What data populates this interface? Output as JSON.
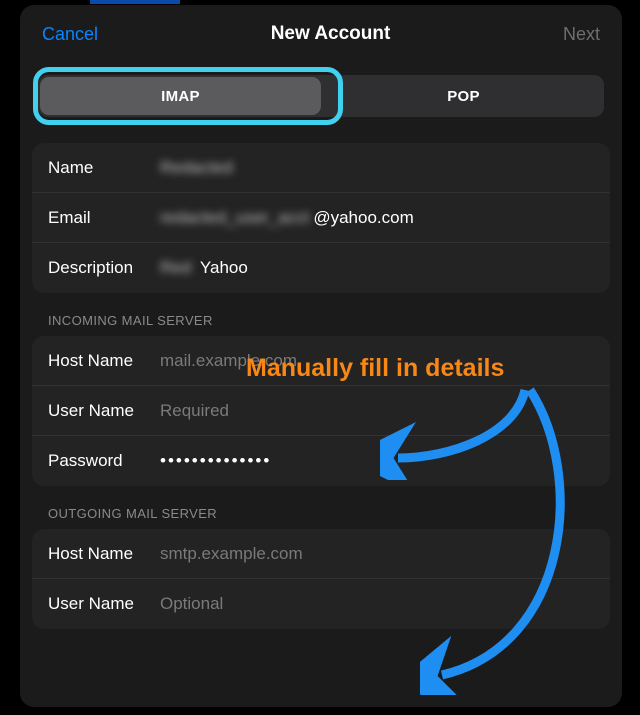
{
  "header": {
    "cancel_label": "Cancel",
    "title": "New Account",
    "next_label": "Next"
  },
  "segment": {
    "imap": "IMAP",
    "pop": "POP"
  },
  "identity": {
    "name_label": "Name",
    "name_value": "Redacted",
    "email_label": "Email",
    "email_prefix": "redacted_user_acct",
    "email_suffix": "@yahoo.com",
    "description_label": "Description",
    "description_prefix": "Red",
    "description_suffix": "Yahoo"
  },
  "incoming": {
    "header": "INCOMING MAIL SERVER",
    "host_label": "Host Name",
    "host_placeholder": "mail.example.com",
    "user_label": "User Name",
    "user_placeholder": "Required",
    "password_label": "Password",
    "password_value": "••••••••••••••"
  },
  "outgoing": {
    "header": "OUTGOING MAIL SERVER",
    "host_label": "Host Name",
    "host_placeholder": "smtp.example.com",
    "user_label": "User Name",
    "user_placeholder": "Optional"
  },
  "annotation": {
    "text": "Manually fill in details",
    "color": "#f78817",
    "arrow_color": "#1f8ef3"
  }
}
